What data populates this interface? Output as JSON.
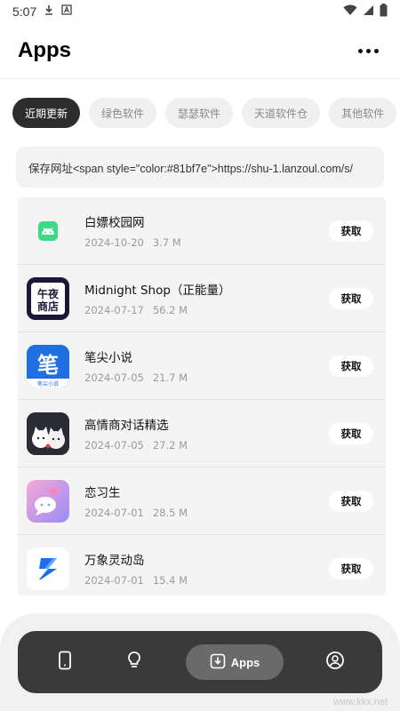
{
  "status_bar": {
    "time": "5:07"
  },
  "header": {
    "title": "Apps"
  },
  "tabs": [
    {
      "label": "近期更新",
      "active": true
    },
    {
      "label": "绿色软件",
      "active": false
    },
    {
      "label": "瑟瑟软件",
      "active": false
    },
    {
      "label": "天道软件仓",
      "active": false
    },
    {
      "label": "其他软件",
      "active": false
    }
  ],
  "notice": {
    "text": "保存网址<span style=\"color:#81bf7e\">https://shu-1.lanzoul.com/s/"
  },
  "apps": [
    {
      "name": "白嫖校园网",
      "date": "2024-10-20",
      "size": "3.7 M",
      "button": "获取",
      "icon": "android-icon"
    },
    {
      "name": "Midnight Shop（正能量）",
      "date": "2024-07-17",
      "size": "56.2 M",
      "button": "获取",
      "icon": "midnight-shop-icon",
      "icon_text": "午夜商店"
    },
    {
      "name": "笔尖小说",
      "date": "2024-07-05",
      "size": "21.7 M",
      "button": "获取",
      "icon": "bijian-novel-icon",
      "icon_text": "笔"
    },
    {
      "name": "高情商对话精选",
      "date": "2024-07-05",
      "size": "27.2 M",
      "button": "获取",
      "icon": "cat-chat-icon"
    },
    {
      "name": "恋习生",
      "date": "2024-07-01",
      "size": "28.5 M",
      "button": "获取",
      "icon": "chat-bubble-icon"
    },
    {
      "name": "万象灵动岛",
      "date": "2024-07-01",
      "size": "15.4 M",
      "button": "获取",
      "icon": "wanxiang-island-icon"
    }
  ],
  "bottom_nav": {
    "items": [
      {
        "icon": "phone-icon",
        "label": ""
      },
      {
        "icon": "bulb-icon",
        "label": ""
      },
      {
        "icon": "download-icon",
        "label": "Apps",
        "active": true
      },
      {
        "icon": "profile-icon",
        "label": ""
      }
    ]
  },
  "watermark": "www.kkx.net",
  "colors": {
    "active_tab": "#2d2d2d",
    "nav_bg": "#3a3a3a",
    "nav_active": "#6a6a6a"
  }
}
